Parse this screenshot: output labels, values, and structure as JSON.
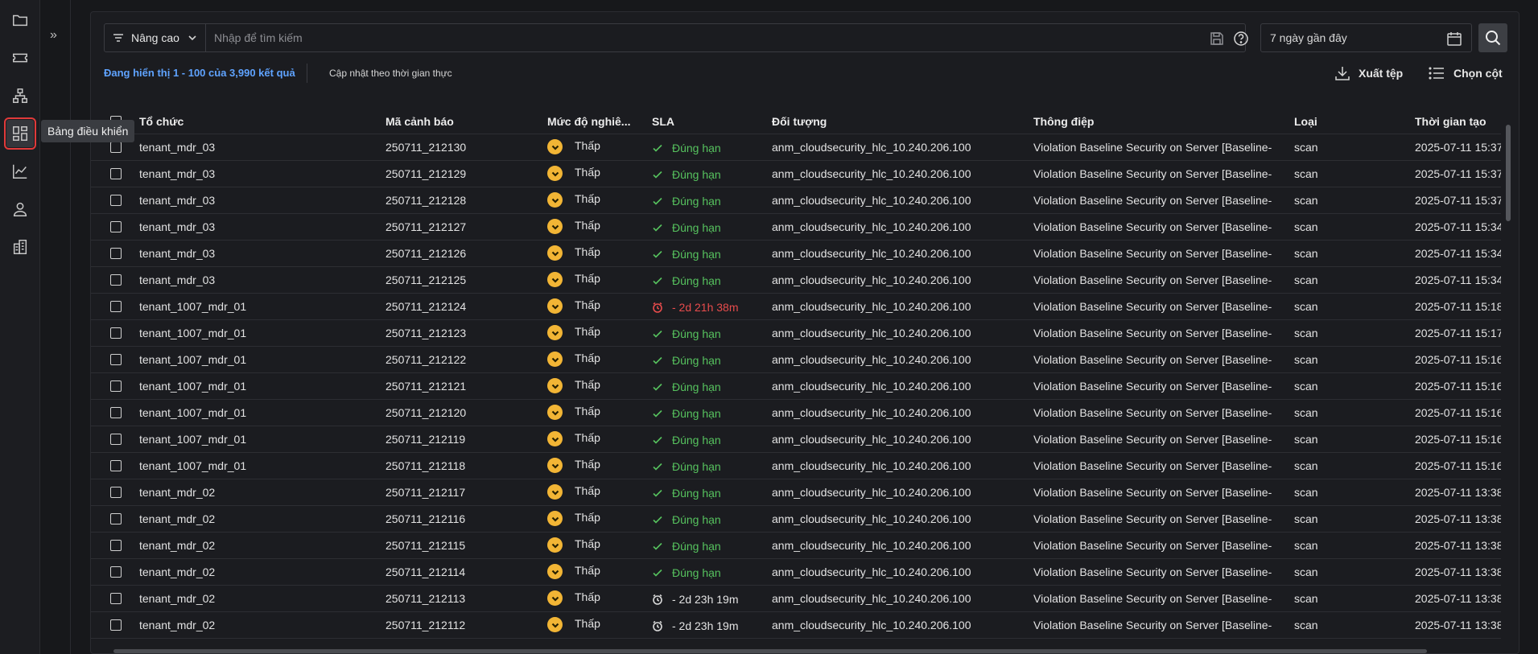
{
  "sidebar": {
    "tooltip": "Bảng điều khiển",
    "items": [
      {
        "icon": "folder-icon"
      },
      {
        "icon": "ticket-icon"
      },
      {
        "icon": "sitemap-icon"
      },
      {
        "icon": "dashboard-icon",
        "active": true
      },
      {
        "icon": "line-chart-icon"
      },
      {
        "icon": "user-icon"
      },
      {
        "icon": "building-icon"
      }
    ]
  },
  "toolbar": {
    "advanced_label": "Nâng cao",
    "search_placeholder": "Nhập để tìm kiếm",
    "date_range": "7 ngày gần đây"
  },
  "summary": {
    "result_text": "Đang hiển thị 1 - 100 của 3,990 kết quả",
    "realtime_label": "Cập nhật theo thời gian thực",
    "export_label": "Xuất tệp",
    "columns_label": "Chọn cột"
  },
  "table": {
    "headers": {
      "org": "Tổ chức",
      "alert_id": "Mã cảnh báo",
      "severity": "Mức độ nghiê...",
      "sla": "SLA",
      "object": "Đối tượng",
      "message": "Thông điệp",
      "type": "Loại",
      "created": "Thời gian tạo"
    },
    "rows": [
      {
        "org": "tenant_mdr_03",
        "alert_id": "250711_212130",
        "severity": "Thấp",
        "sla_status": "ok",
        "sla": "Đúng hạn",
        "object": "anm_cloudsecurity_hlc_10.240.206.100",
        "message": "Violation Baseline Security on Server [Baseline-",
        "type": "scan",
        "created": "2025-07-11 15:37:"
      },
      {
        "org": "tenant_mdr_03",
        "alert_id": "250711_212129",
        "severity": "Thấp",
        "sla_status": "ok",
        "sla": "Đúng hạn",
        "object": "anm_cloudsecurity_hlc_10.240.206.100",
        "message": "Violation Baseline Security on Server [Baseline-",
        "type": "scan",
        "created": "2025-07-11 15:37:"
      },
      {
        "org": "tenant_mdr_03",
        "alert_id": "250711_212128",
        "severity": "Thấp",
        "sla_status": "ok",
        "sla": "Đúng hạn",
        "object": "anm_cloudsecurity_hlc_10.240.206.100",
        "message": "Violation Baseline Security on Server [Baseline-",
        "type": "scan",
        "created": "2025-07-11 15:37:"
      },
      {
        "org": "tenant_mdr_03",
        "alert_id": "250711_212127",
        "severity": "Thấp",
        "sla_status": "ok",
        "sla": "Đúng hạn",
        "object": "anm_cloudsecurity_hlc_10.240.206.100",
        "message": "Violation Baseline Security on Server [Baseline-",
        "type": "scan",
        "created": "2025-07-11 15:34:"
      },
      {
        "org": "tenant_mdr_03",
        "alert_id": "250711_212126",
        "severity": "Thấp",
        "sla_status": "ok",
        "sla": "Đúng hạn",
        "object": "anm_cloudsecurity_hlc_10.240.206.100",
        "message": "Violation Baseline Security on Server [Baseline-",
        "type": "scan",
        "created": "2025-07-11 15:34:"
      },
      {
        "org": "tenant_mdr_03",
        "alert_id": "250711_212125",
        "severity": "Thấp",
        "sla_status": "ok",
        "sla": "Đúng hạn",
        "object": "anm_cloudsecurity_hlc_10.240.206.100",
        "message": "Violation Baseline Security on Server [Baseline-",
        "type": "scan",
        "created": "2025-07-11 15:34:"
      },
      {
        "org": "tenant_1007_mdr_01",
        "alert_id": "250711_212124",
        "severity": "Thấp",
        "sla_status": "late",
        "sla": "- 2d 21h 38m",
        "object": "anm_cloudsecurity_hlc_10.240.206.100",
        "message": "Violation Baseline Security on Server [Baseline-",
        "type": "scan",
        "created": "2025-07-11 15:18:"
      },
      {
        "org": "tenant_1007_mdr_01",
        "alert_id": "250711_212123",
        "severity": "Thấp",
        "sla_status": "ok",
        "sla": "Đúng hạn",
        "object": "anm_cloudsecurity_hlc_10.240.206.100",
        "message": "Violation Baseline Security on Server [Baseline-",
        "type": "scan",
        "created": "2025-07-11 15:17:"
      },
      {
        "org": "tenant_1007_mdr_01",
        "alert_id": "250711_212122",
        "severity": "Thấp",
        "sla_status": "ok",
        "sla": "Đúng hạn",
        "object": "anm_cloudsecurity_hlc_10.240.206.100",
        "message": "Violation Baseline Security on Server [Baseline-",
        "type": "scan",
        "created": "2025-07-11 15:16:"
      },
      {
        "org": "tenant_1007_mdr_01",
        "alert_id": "250711_212121",
        "severity": "Thấp",
        "sla_status": "ok",
        "sla": "Đúng hạn",
        "object": "anm_cloudsecurity_hlc_10.240.206.100",
        "message": "Violation Baseline Security on Server [Baseline-",
        "type": "scan",
        "created": "2025-07-11 15:16:"
      },
      {
        "org": "tenant_1007_mdr_01",
        "alert_id": "250711_212120",
        "severity": "Thấp",
        "sla_status": "ok",
        "sla": "Đúng hạn",
        "object": "anm_cloudsecurity_hlc_10.240.206.100",
        "message": "Violation Baseline Security on Server [Baseline-",
        "type": "scan",
        "created": "2025-07-11 15:16:"
      },
      {
        "org": "tenant_1007_mdr_01",
        "alert_id": "250711_212119",
        "severity": "Thấp",
        "sla_status": "ok",
        "sla": "Đúng hạn",
        "object": "anm_cloudsecurity_hlc_10.240.206.100",
        "message": "Violation Baseline Security on Server [Baseline-",
        "type": "scan",
        "created": "2025-07-11 15:16:"
      },
      {
        "org": "tenant_1007_mdr_01",
        "alert_id": "250711_212118",
        "severity": "Thấp",
        "sla_status": "ok",
        "sla": "Đúng hạn",
        "object": "anm_cloudsecurity_hlc_10.240.206.100",
        "message": "Violation Baseline Security on Server [Baseline-",
        "type": "scan",
        "created": "2025-07-11 15:16:"
      },
      {
        "org": "tenant_mdr_02",
        "alert_id": "250711_212117",
        "severity": "Thấp",
        "sla_status": "ok",
        "sla": "Đúng hạn",
        "object": "anm_cloudsecurity_hlc_10.240.206.100",
        "message": "Violation Baseline Security on Server [Baseline-",
        "type": "scan",
        "created": "2025-07-11 13:38:"
      },
      {
        "org": "tenant_mdr_02",
        "alert_id": "250711_212116",
        "severity": "Thấp",
        "sla_status": "ok",
        "sla": "Đúng hạn",
        "object": "anm_cloudsecurity_hlc_10.240.206.100",
        "message": "Violation Baseline Security on Server [Baseline-",
        "type": "scan",
        "created": "2025-07-11 13:38:"
      },
      {
        "org": "tenant_mdr_02",
        "alert_id": "250711_212115",
        "severity": "Thấp",
        "sla_status": "ok",
        "sla": "Đúng hạn",
        "object": "anm_cloudsecurity_hlc_10.240.206.100",
        "message": "Violation Baseline Security on Server [Baseline-",
        "type": "scan",
        "created": "2025-07-11 13:38:"
      },
      {
        "org": "tenant_mdr_02",
        "alert_id": "250711_212114",
        "severity": "Thấp",
        "sla_status": "ok",
        "sla": "Đúng hạn",
        "object": "anm_cloudsecurity_hlc_10.240.206.100",
        "message": "Violation Baseline Security on Server [Baseline-",
        "type": "scan",
        "created": "2025-07-11 13:38:"
      },
      {
        "org": "tenant_mdr_02",
        "alert_id": "250711_212113",
        "severity": "Thấp",
        "sla_status": "pending",
        "sla": "- 2d 23h 19m",
        "object": "anm_cloudsecurity_hlc_10.240.206.100",
        "message": "Violation Baseline Security on Server [Baseline-",
        "type": "scan",
        "created": "2025-07-11 13:38:"
      },
      {
        "org": "tenant_mdr_02",
        "alert_id": "250711_212112",
        "severity": "Thấp",
        "sla_status": "pending",
        "sla": "- 2d 23h 19m",
        "object": "anm_cloudsecurity_hlc_10.240.206.100",
        "message": "Violation Baseline Security on Server [Baseline-",
        "type": "scan",
        "created": "2025-07-11 13:38:"
      }
    ]
  },
  "colors": {
    "link_blue": "#5fa3ff",
    "severity_low": "#f2b535",
    "sla_ok": "#56c25e",
    "sla_late": "#e84c4c"
  }
}
